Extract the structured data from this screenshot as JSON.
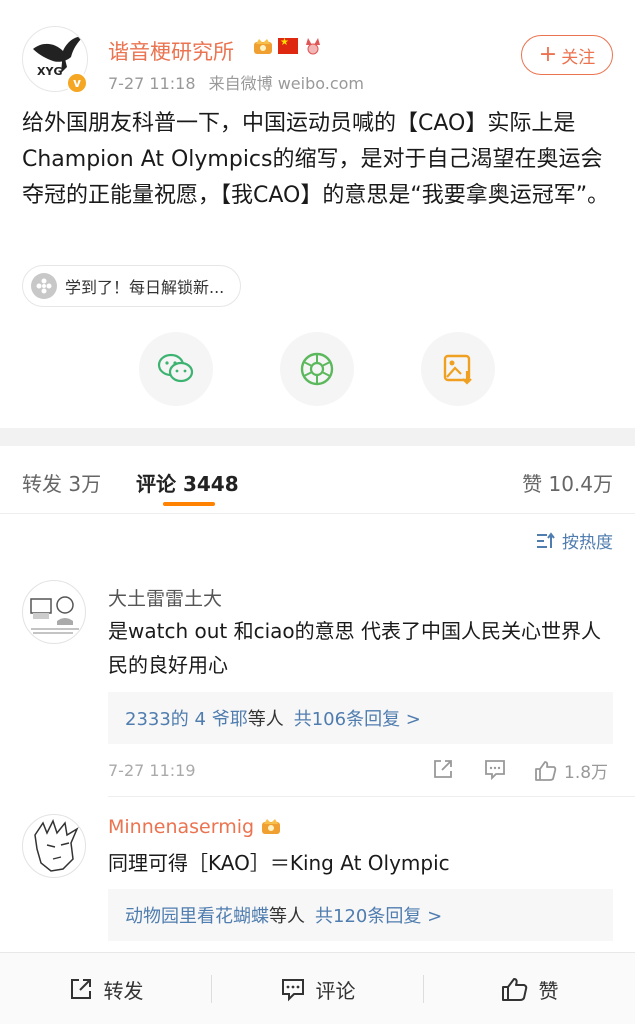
{
  "post": {
    "author": "谐音梗研究所",
    "avatar_text": "XYG",
    "verified_mark": "v",
    "time": "7-27 11:18",
    "source": "来自微博 weibo.com",
    "follow_label": "关注",
    "follow_plus": "+",
    "text": "给外国朋友科普一下，中国运动员喊的【CAO】实际上是Champion At Olympics的缩写，是对于自己渴望在奥运会夺冠的正能量祝愿，【我CAO】的意思是“我要拿奥运冠军”。",
    "tag": "学到了！每日解锁新...",
    "share_icons": [
      "wechat-icon",
      "moments-icon",
      "save-image-icon"
    ]
  },
  "tabs": {
    "repost_label": "转发",
    "repost_count": "3万",
    "comment_label": "评论",
    "comment_count": "3448",
    "like_label": "赞",
    "like_count": "10.4万"
  },
  "sort_label": "按热度",
  "comments": [
    {
      "name": "大土雷雷土大",
      "text": "是watch out 和ciao的意思  代表了中国人民关心世界人民的良好用心",
      "replies_names": "2333的 4 爷耶",
      "replies_mid": "等人",
      "replies_total": "共106条回复 >",
      "time": "7-27 11:19",
      "likes": "1.8万"
    },
    {
      "name": "Minnenasermig",
      "text": "同理可得［KAO］＝King At Olympic",
      "replies_names": "动物园里看花蝴蝶",
      "replies_mid": "等人",
      "replies_total": "共120条回复 >"
    }
  ],
  "bottom": {
    "repost": "转发",
    "comment": "评论",
    "like": "赞"
  },
  "colors": {
    "accent_orange": "#eb7350",
    "link_blue": "#507daf",
    "tab_underline": "#ff8200"
  }
}
